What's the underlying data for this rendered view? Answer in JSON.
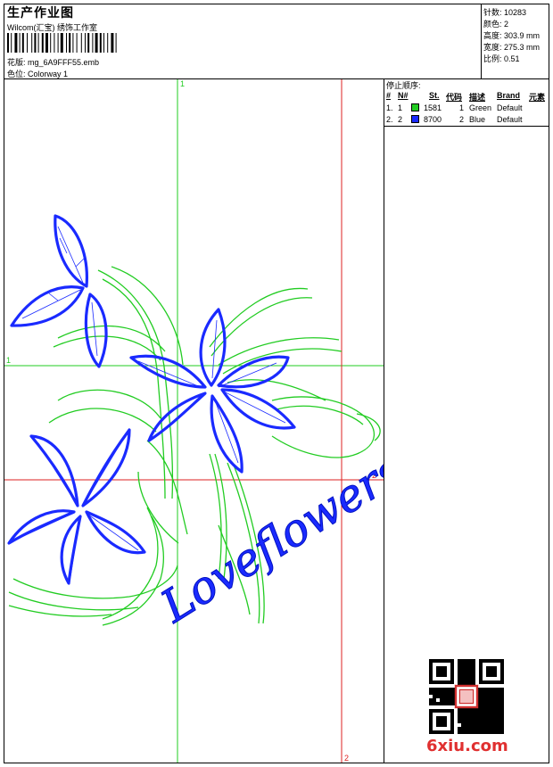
{
  "header": {
    "title": "生产作业图",
    "company": "Wilcom(汇宝) 绣饰工作室",
    "design_label": "花版:",
    "design_file": "mg_6A9FFF55.emb",
    "colorway_label": "色位:",
    "colorway": "Colorway 1"
  },
  "stats": {
    "stitches_label": "针数:",
    "stitches": "10283",
    "colors_label": "颜色:",
    "colors": "2",
    "height_label": "高度:",
    "height": "303.9 mm",
    "width_label": "宽度:",
    "width": "275.3 mm",
    "scale_label": "比例:",
    "scale": "0.51"
  },
  "stop_sequence": {
    "title": "停止顺序:",
    "headers": [
      "#",
      "N#",
      "St.",
      "代码",
      "描述",
      "Brand",
      "元素"
    ],
    "rows": [
      {
        "num": "1.",
        "n": "1",
        "color": "#22cc22",
        "code": "1581",
        "st": "1",
        "desc": "Green",
        "brand": "Default"
      },
      {
        "num": "2.",
        "n": "2",
        "color": "#1a2aff",
        "code": "8700",
        "st": "2",
        "desc": "Blue",
        "brand": "Default"
      }
    ]
  },
  "axes": {
    "green_top": "1",
    "green_left": "1",
    "red_right": "2",
    "red_bottom": "2"
  },
  "design_text": "Loveflowers",
  "watermark": "6xiu.com",
  "colors": {
    "green": "#22cc22",
    "blue": "#1a2aff",
    "red": "#dd2222"
  }
}
